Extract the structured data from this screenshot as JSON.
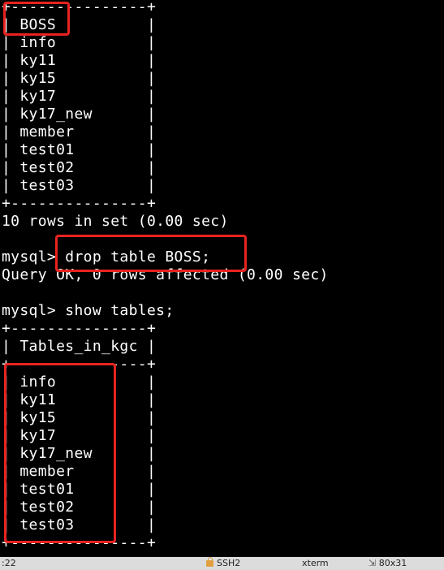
{
  "terminal": {
    "lines": [
      "+---------------+",
      "| BOSS          |",
      "| info          |",
      "| ky11          |",
      "| ky15          |",
      "| ky17          |",
      "| ky17_new      |",
      "| member        |",
      "| test01        |",
      "| test02        |",
      "| test03        |",
      "+---------------+",
      "10 rows in set (0.00 sec)",
      "",
      "mysql> drop table BOSS;",
      "Query OK, 0 rows affected (0.00 sec)",
      "",
      "mysql> show tables;",
      "+---------------+",
      "| Tables_in_kgc |",
      "+---------------+",
      "| info          |",
      "| ky11          |",
      "| ky15          |",
      "| ky17          |",
      "| ky17_new      |",
      "| member        |",
      "| test01        |",
      "| test02        |",
      "| test03        |",
      "+---------------+"
    ]
  },
  "colors": {
    "background": "#000000",
    "text": "#ffffff",
    "highlight": "#e8231f",
    "statusbar": "#dcdcdc"
  },
  "statusbar": {
    "left": ":22",
    "session": "SSH2",
    "term": "xterm",
    "size": "80x31",
    "icons": [
      "lock-icon",
      "resize-icon"
    ]
  }
}
